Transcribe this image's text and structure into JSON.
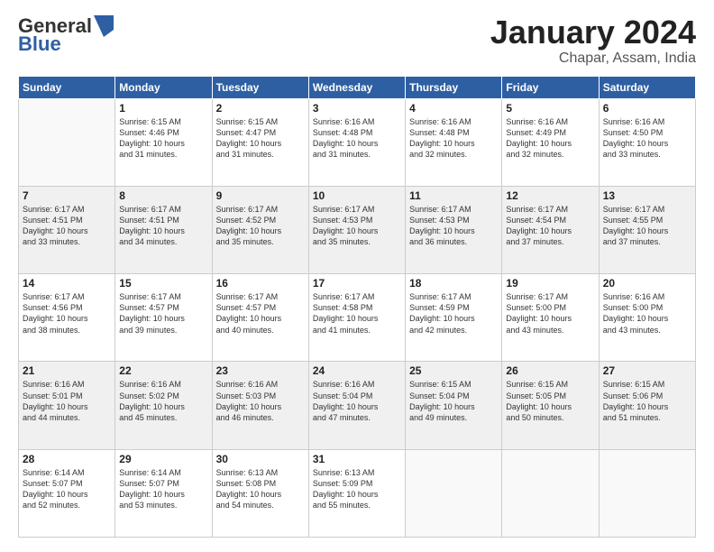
{
  "logo": {
    "general": "General",
    "blue": "Blue"
  },
  "header": {
    "month_title": "January 2024",
    "location": "Chapar, Assam, India"
  },
  "days_of_week": [
    "Sunday",
    "Monday",
    "Tuesday",
    "Wednesday",
    "Thursday",
    "Friday",
    "Saturday"
  ],
  "weeks": [
    [
      {
        "day": "",
        "info": ""
      },
      {
        "day": "1",
        "info": "Sunrise: 6:15 AM\nSunset: 4:46 PM\nDaylight: 10 hours\nand 31 minutes."
      },
      {
        "day": "2",
        "info": "Sunrise: 6:15 AM\nSunset: 4:47 PM\nDaylight: 10 hours\nand 31 minutes."
      },
      {
        "day": "3",
        "info": "Sunrise: 6:16 AM\nSunset: 4:48 PM\nDaylight: 10 hours\nand 31 minutes."
      },
      {
        "day": "4",
        "info": "Sunrise: 6:16 AM\nSunset: 4:48 PM\nDaylight: 10 hours\nand 32 minutes."
      },
      {
        "day": "5",
        "info": "Sunrise: 6:16 AM\nSunset: 4:49 PM\nDaylight: 10 hours\nand 32 minutes."
      },
      {
        "day": "6",
        "info": "Sunrise: 6:16 AM\nSunset: 4:50 PM\nDaylight: 10 hours\nand 33 minutes."
      }
    ],
    [
      {
        "day": "7",
        "info": "Sunrise: 6:17 AM\nSunset: 4:51 PM\nDaylight: 10 hours\nand 33 minutes."
      },
      {
        "day": "8",
        "info": "Sunrise: 6:17 AM\nSunset: 4:51 PM\nDaylight: 10 hours\nand 34 minutes."
      },
      {
        "day": "9",
        "info": "Sunrise: 6:17 AM\nSunset: 4:52 PM\nDaylight: 10 hours\nand 35 minutes."
      },
      {
        "day": "10",
        "info": "Sunrise: 6:17 AM\nSunset: 4:53 PM\nDaylight: 10 hours\nand 35 minutes."
      },
      {
        "day": "11",
        "info": "Sunrise: 6:17 AM\nSunset: 4:53 PM\nDaylight: 10 hours\nand 36 minutes."
      },
      {
        "day": "12",
        "info": "Sunrise: 6:17 AM\nSunset: 4:54 PM\nDaylight: 10 hours\nand 37 minutes."
      },
      {
        "day": "13",
        "info": "Sunrise: 6:17 AM\nSunset: 4:55 PM\nDaylight: 10 hours\nand 37 minutes."
      }
    ],
    [
      {
        "day": "14",
        "info": "Sunrise: 6:17 AM\nSunset: 4:56 PM\nDaylight: 10 hours\nand 38 minutes."
      },
      {
        "day": "15",
        "info": "Sunrise: 6:17 AM\nSunset: 4:57 PM\nDaylight: 10 hours\nand 39 minutes."
      },
      {
        "day": "16",
        "info": "Sunrise: 6:17 AM\nSunset: 4:57 PM\nDaylight: 10 hours\nand 40 minutes."
      },
      {
        "day": "17",
        "info": "Sunrise: 6:17 AM\nSunset: 4:58 PM\nDaylight: 10 hours\nand 41 minutes."
      },
      {
        "day": "18",
        "info": "Sunrise: 6:17 AM\nSunset: 4:59 PM\nDaylight: 10 hours\nand 42 minutes."
      },
      {
        "day": "19",
        "info": "Sunrise: 6:17 AM\nSunset: 5:00 PM\nDaylight: 10 hours\nand 43 minutes."
      },
      {
        "day": "20",
        "info": "Sunrise: 6:16 AM\nSunset: 5:00 PM\nDaylight: 10 hours\nand 43 minutes."
      }
    ],
    [
      {
        "day": "21",
        "info": "Sunrise: 6:16 AM\nSunset: 5:01 PM\nDaylight: 10 hours\nand 44 minutes."
      },
      {
        "day": "22",
        "info": "Sunrise: 6:16 AM\nSunset: 5:02 PM\nDaylight: 10 hours\nand 45 minutes."
      },
      {
        "day": "23",
        "info": "Sunrise: 6:16 AM\nSunset: 5:03 PM\nDaylight: 10 hours\nand 46 minutes."
      },
      {
        "day": "24",
        "info": "Sunrise: 6:16 AM\nSunset: 5:04 PM\nDaylight: 10 hours\nand 47 minutes."
      },
      {
        "day": "25",
        "info": "Sunrise: 6:15 AM\nSunset: 5:04 PM\nDaylight: 10 hours\nand 49 minutes."
      },
      {
        "day": "26",
        "info": "Sunrise: 6:15 AM\nSunset: 5:05 PM\nDaylight: 10 hours\nand 50 minutes."
      },
      {
        "day": "27",
        "info": "Sunrise: 6:15 AM\nSunset: 5:06 PM\nDaylight: 10 hours\nand 51 minutes."
      }
    ],
    [
      {
        "day": "28",
        "info": "Sunrise: 6:14 AM\nSunset: 5:07 PM\nDaylight: 10 hours\nand 52 minutes."
      },
      {
        "day": "29",
        "info": "Sunrise: 6:14 AM\nSunset: 5:07 PM\nDaylight: 10 hours\nand 53 minutes."
      },
      {
        "day": "30",
        "info": "Sunrise: 6:13 AM\nSunset: 5:08 PM\nDaylight: 10 hours\nand 54 minutes."
      },
      {
        "day": "31",
        "info": "Sunrise: 6:13 AM\nSunset: 5:09 PM\nDaylight: 10 hours\nand 55 minutes."
      },
      {
        "day": "",
        "info": ""
      },
      {
        "day": "",
        "info": ""
      },
      {
        "day": "",
        "info": ""
      }
    ]
  ]
}
